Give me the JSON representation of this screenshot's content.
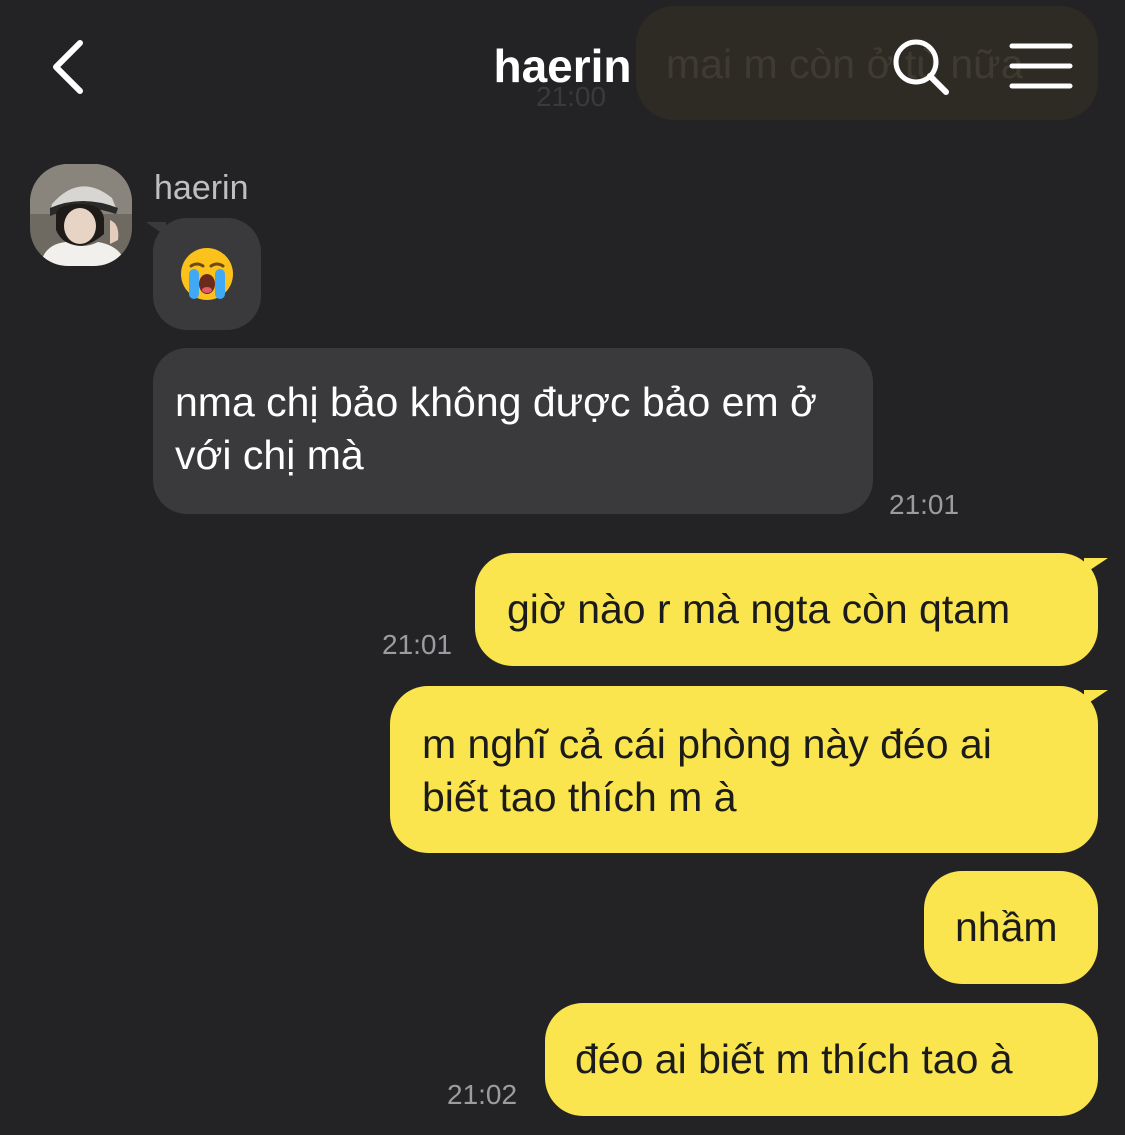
{
  "faded_message": {
    "text": "mai m còn ở tù nữa",
    "time": "21:00"
  },
  "header": {
    "title": "haerin",
    "back_icon": "chevron-left-icon",
    "search_icon": "search-icon",
    "menu_icon": "hamburger-menu-icon"
  },
  "incoming": {
    "sender_name": "haerin",
    "emoji": "😭",
    "message_1": "nma chị bảo không được bảo em ở với chị mà",
    "message_1_time": "21:01"
  },
  "outgoing": [
    {
      "text": "giờ nào r mà ngta còn qtam",
      "time": "21:01"
    },
    {
      "text": "m nghĩ cả cái phòng này đéo ai biết tao thích m à",
      "time": ""
    },
    {
      "text": "nhầm",
      "time": ""
    },
    {
      "text": "đéo ai biết m thích tao à",
      "time": "21:02"
    }
  ],
  "colors": {
    "background": "#232325",
    "incoming_bubble": "#3a3a3c",
    "outgoing_bubble": "#fae54e",
    "timestamp": "#9c9ca0"
  }
}
